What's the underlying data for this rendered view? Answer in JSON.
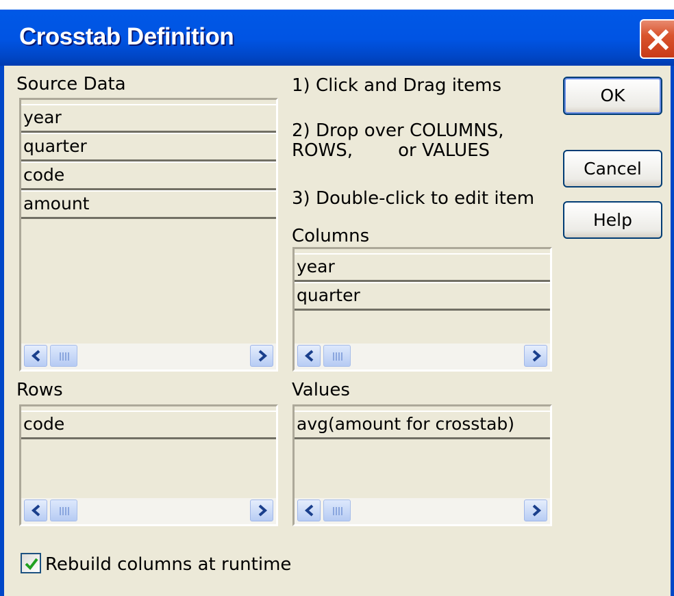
{
  "window": {
    "title": "Crosstab Definition",
    "close_icon": "close-icon"
  },
  "instructions": {
    "step1": "1) Click and Drag items",
    "step2_line1": "2) Drop over COLUMNS,",
    "step2_line2": "ROWS,        or VALUES",
    "step3": "3) Double-click to edit item"
  },
  "source_data": {
    "label": "Source Data",
    "items": [
      "year",
      "quarter",
      "code",
      "amount"
    ]
  },
  "columns": {
    "label": "Columns",
    "items": [
      "year",
      "quarter"
    ]
  },
  "rows": {
    "label": "Rows",
    "items": [
      "code"
    ]
  },
  "values": {
    "label": "Values",
    "items": [
      "avg(amount for crosstab)"
    ]
  },
  "buttons": {
    "ok": "OK",
    "cancel": "Cancel",
    "help": "Help"
  },
  "options": {
    "rebuild_label": "Rebuild columns at runtime",
    "rebuild_checked": true
  },
  "colors": {
    "title_bar": "#0054e3",
    "dialog_bg": "#ece9d8",
    "close_button": "#d9542e",
    "check_mark": "#21a121"
  }
}
